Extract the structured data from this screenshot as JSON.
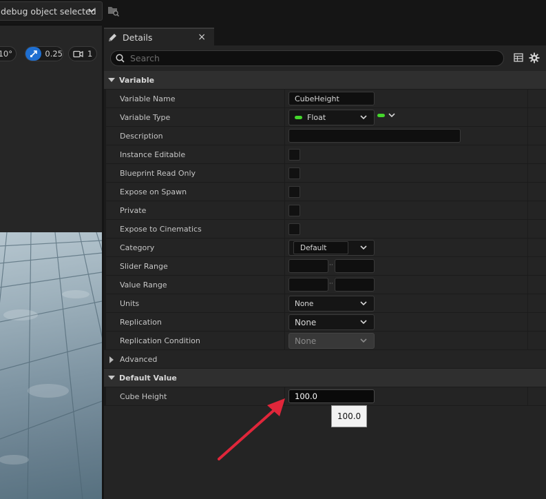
{
  "toolbar": {
    "debug_selector": "debug object selected",
    "browse_icon": "folder-browse-icon"
  },
  "viewport": {
    "rotation_snap": "10°",
    "scale_snap": "0.25",
    "camera_speed": "1"
  },
  "details": {
    "tab_label": "Details",
    "search_placeholder": "Search",
    "categories": {
      "variable": "Variable",
      "advanced": "Advanced",
      "default_value": "Default Value"
    },
    "properties": {
      "variable_name": {
        "label": "Variable Name",
        "value": "CubeHeight"
      },
      "variable_type": {
        "label": "Variable Type",
        "value": "Float"
      },
      "description": {
        "label": "Description",
        "value": ""
      },
      "instance_editable": {
        "label": "Instance Editable"
      },
      "blueprint_read_only": {
        "label": "Blueprint Read Only"
      },
      "expose_on_spawn": {
        "label": "Expose on Spawn"
      },
      "private": {
        "label": "Private"
      },
      "expose_to_cinematics": {
        "label": "Expose to Cinematics"
      },
      "category": {
        "label": "Category",
        "value": "Default"
      },
      "slider_range": {
        "label": "Slider Range",
        "min": "",
        "max": ""
      },
      "value_range": {
        "label": "Value Range",
        "min": "",
        "max": ""
      },
      "units": {
        "label": "Units",
        "value": "None"
      },
      "replication": {
        "label": "Replication",
        "value": "None"
      },
      "replication_condition": {
        "label": "Replication Condition",
        "value": "None"
      },
      "cube_height": {
        "label": "Cube Height",
        "value": "100.0"
      }
    },
    "tooltip": "100.0"
  },
  "colors": {
    "accent_blue": "#1f6fd1",
    "float_pin_green": "#44d62c",
    "annotation_arrow": "#e0263a"
  }
}
